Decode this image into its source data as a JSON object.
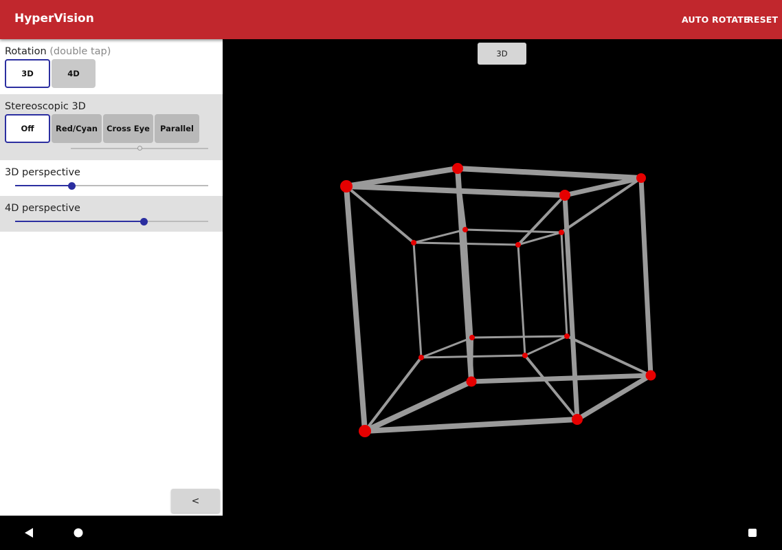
{
  "appbar": {
    "title": "HyperVision",
    "auto_rotate": "AUTO ROTATE",
    "reset": "RESET"
  },
  "rotation": {
    "label": "Rotation",
    "hint": "(double tap)",
    "options": [
      "3D",
      "4D"
    ],
    "selected": "3D"
  },
  "stereo": {
    "label": "Stereoscopic 3D",
    "options": [
      "Off",
      "Red/Cyan",
      "Cross Eye",
      "Parallel"
    ],
    "selected": "Off",
    "slider_value": 0.5
  },
  "perspective3d": {
    "label": "3D perspective",
    "value": 0.3
  },
  "perspective4d": {
    "label": "4D perspective",
    "value": 0.67
  },
  "collapse_button": "<",
  "viewport": {
    "mode_button": "3D",
    "colors": {
      "edge": "#9a9a9a",
      "vertex": "#e60000",
      "background": "#000000"
    }
  },
  "nav": {
    "back_icon": "back-triangle-icon",
    "home_icon": "home-circle-icon",
    "recents_icon": "recents-square-icon"
  }
}
